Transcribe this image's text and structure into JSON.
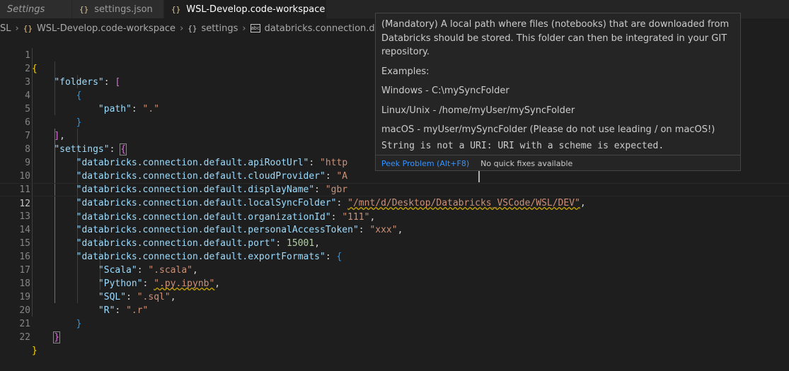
{
  "tabs": [
    {
      "label": "Settings",
      "icon": "",
      "italic": true,
      "active": false
    },
    {
      "label": "settings.json",
      "icon": "{}",
      "italic": false,
      "active": false
    },
    {
      "label": "WSL-Develop.code-workspace",
      "icon": "{}",
      "italic": false,
      "active": true,
      "dirty": true
    }
  ],
  "breadcrumb": {
    "items": [
      "SL",
      "WSL-Develop.code-workspace",
      "settings",
      "databricks.connection.default.o"
    ]
  },
  "editor": {
    "current_line": 12,
    "line_numbers": [
      "1",
      "2",
      "3",
      "4",
      "5",
      "6",
      "7",
      "8",
      "9",
      "10",
      "11",
      "12",
      "13",
      "14",
      "15",
      "16",
      "17",
      "18",
      "19",
      "20",
      "21",
      "22"
    ]
  },
  "code": {
    "folders_key": "\"folders\"",
    "path_key": "\"path\"",
    "path_val": "\".\"",
    "settings_key": "\"settings\"",
    "apiRootUrl_key": "\"databricks.connection.default.apiRootUrl\"",
    "apiRootUrl_val": "\"http",
    "cloudProvider_key": "\"databricks.connection.default.cloudProvider\"",
    "cloudProvider_val": "\"A",
    "displayName_key": "\"databricks.connection.default.displayName\"",
    "displayName_val": "\"gbr",
    "localSyncFolder_key": "\"databricks.connection.default.localSyncFolder\"",
    "localSyncFolder_val": "\"/mnt/d/Desktop/Databricks_VSCode/WSL/DEV\"",
    "organizationId_key": "\"databricks.connection.default.organizationId\"",
    "organizationId_val": "\"111\"",
    "personalAccessToken_key": "\"databricks.connection.default.personalAccessToken\"",
    "personalAccessToken_val": "\"xxx\"",
    "port_key": "\"databricks.connection.default.port\"",
    "port_val": "15001",
    "exportFormats_key": "\"databricks.connection.default.exportFormats\"",
    "scala_key": "\"Scala\"",
    "scala_val": "\".scala\"",
    "python_key": "\"Python\"",
    "python_val": "\".py.ipynb\"",
    "sql_key": "\"SQL\"",
    "sql_val": "\".sql\"",
    "r_key": "\"R\"",
    "r_val": "\".r\""
  },
  "hover": {
    "description": "(Mandatory) A local path where files (notebooks) that are downloaded from Databricks should be stored. This folder can then be integrated in your GIT repository.",
    "examples_label": "Examples:",
    "windows": "Windows - C:\\mySyncFolder",
    "linux": "Linux/Unix - /home/myUser/mySyncFolder",
    "macos": "macOS - myUser/mySyncFolder (Please do not use leading / on macOS!)",
    "error": "String is not a URI: URI with a scheme is expected.",
    "peek_problem": "Peek Problem (Alt+F8)",
    "no_quick_fixes": "No quick fixes available"
  },
  "colors": {
    "editor_bg": "#1e1e1e",
    "key": "#9cdcfe",
    "string": "#ce9178",
    "number": "#b5cea8",
    "link": "#3794ff",
    "warning": "#cca700"
  }
}
